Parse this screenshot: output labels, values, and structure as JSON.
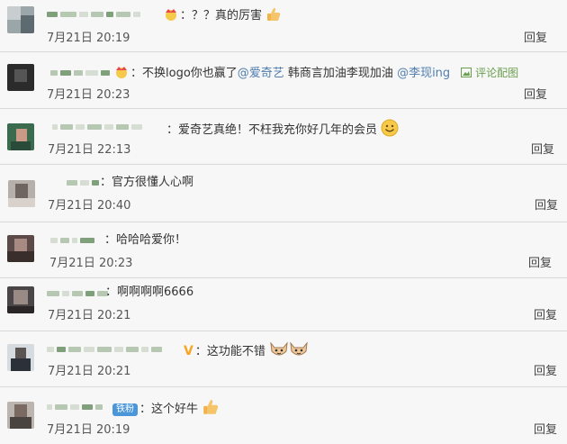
{
  "reply_label": "回复",
  "comments": [
    {
      "text": "：？？真的厉害",
      "time": "7月21日 20:19"
    },
    {
      "text_pre": "：不换logo你也赢了",
      "mention1": "@爱奇艺",
      "text_mid": " 韩商言加油李现加油 ",
      "mention2": "@李现ing",
      "pic_label": "评论配图",
      "time": "7月21日 20:23"
    },
    {
      "text": "：爱奇艺真绝！不枉我充你好几年的会员",
      "time": "7月21日 22:13"
    },
    {
      "text": "：官方很懂人心啊",
      "time": "7月21日 20:40"
    },
    {
      "text": "：哈哈哈爱你！",
      "time": "7月21日 20:23"
    },
    {
      "text": "：啊啊啊啊6666",
      "time": "7月21日 20:21"
    },
    {
      "text": "：这功能不错",
      "badge": "V",
      "time": "7月21日 20:21"
    },
    {
      "text": "：这个好牛",
      "badge": "铁粉",
      "time": "7月21日 20:19"
    }
  ],
  "icons": {
    "crown": "crown-icon",
    "thumb": "thumbs-up-icon",
    "smile": "smile-icon",
    "cat": "cat-face-icon",
    "picture": "picture-icon"
  },
  "colors": {
    "mention": "#507daf",
    "fan_badge": "#4a96d8",
    "vip": "#f5a623"
  }
}
